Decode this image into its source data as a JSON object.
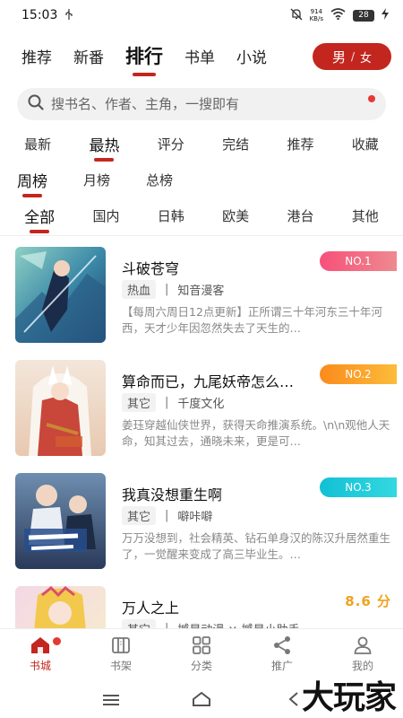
{
  "status_bar": {
    "time": "15:03",
    "usb_icon": "usb-icon",
    "net_speed_value": "914",
    "net_speed_unit": "KB/s",
    "battery": "28"
  },
  "top_nav": {
    "tabs": [
      {
        "label": "推荐",
        "active": false
      },
      {
        "label": "新番",
        "active": false
      },
      {
        "label": "排行",
        "active": true
      },
      {
        "label": "书单",
        "active": false
      },
      {
        "label": "小说",
        "active": false
      }
    ],
    "gender": {
      "male": "男",
      "sep": "/",
      "female": "女"
    }
  },
  "search": {
    "placeholder": "搜书名、作者、主角，一搜即有"
  },
  "filters": {
    "sort": [
      {
        "label": "最新",
        "active": false
      },
      {
        "label": "最热",
        "active": true
      },
      {
        "label": "评分",
        "active": false
      },
      {
        "label": "完结",
        "active": false
      },
      {
        "label": "推荐",
        "active": false
      },
      {
        "label": "收藏",
        "active": false
      }
    ],
    "period": [
      {
        "label": "周榜",
        "active": true
      },
      {
        "label": "月榜",
        "active": false
      },
      {
        "label": "总榜",
        "active": false
      }
    ],
    "region": [
      {
        "label": "全部",
        "active": true
      },
      {
        "label": "国内",
        "active": false
      },
      {
        "label": "日韩",
        "active": false
      },
      {
        "label": "欧美",
        "active": false
      },
      {
        "label": "港台",
        "active": false
      },
      {
        "label": "其他",
        "active": false
      }
    ]
  },
  "books": [
    {
      "title": "斗破苍穹",
      "tag": "热血",
      "author": "知音漫客",
      "description": "【每周六周日12点更新】正所谓三十年河东三十年河西，天才少年因忽然失去了天生的…",
      "rank": "NO.1",
      "rank_color": "#f06277"
    },
    {
      "title": "算命而已，九尾妖帝怎么…",
      "tag": "其它",
      "author": "千度文化",
      "description": "姜珏穿越仙侠世界，获得天命推演系统。\\n\\n观他人天命，知其过去，通晓未来，更是可…",
      "rank": "NO.2",
      "rank_color": "#fba128"
    },
    {
      "title": "我真没想重生啊",
      "tag": "其它",
      "author": "噼咔噼",
      "description": "万万没想到，社会精英、钻石单身汉的陈汉升居然重生了，一觉醒来变成了高三毕业生。…",
      "rank": "NO.3",
      "rank_color": "#1ec8d6"
    },
    {
      "title": "万人之上",
      "tag": "其它",
      "author": "撼星动漫 × 撼星小助手",
      "description": "",
      "score": "8.6 分"
    }
  ],
  "bottom_nav": [
    {
      "label": "书城",
      "icon": "bookstore-icon",
      "active": true
    },
    {
      "label": "书架",
      "icon": "bookshelf-icon",
      "active": false
    },
    {
      "label": "分类",
      "icon": "category-icon",
      "active": false
    },
    {
      "label": "推广",
      "icon": "share-icon",
      "active": false
    },
    {
      "label": "我的",
      "icon": "profile-icon",
      "active": false
    }
  ],
  "watermark": "大玩家",
  "colors": {
    "accent": "#c3261f",
    "score": "#f0a21e",
    "dot": "#e53935"
  }
}
